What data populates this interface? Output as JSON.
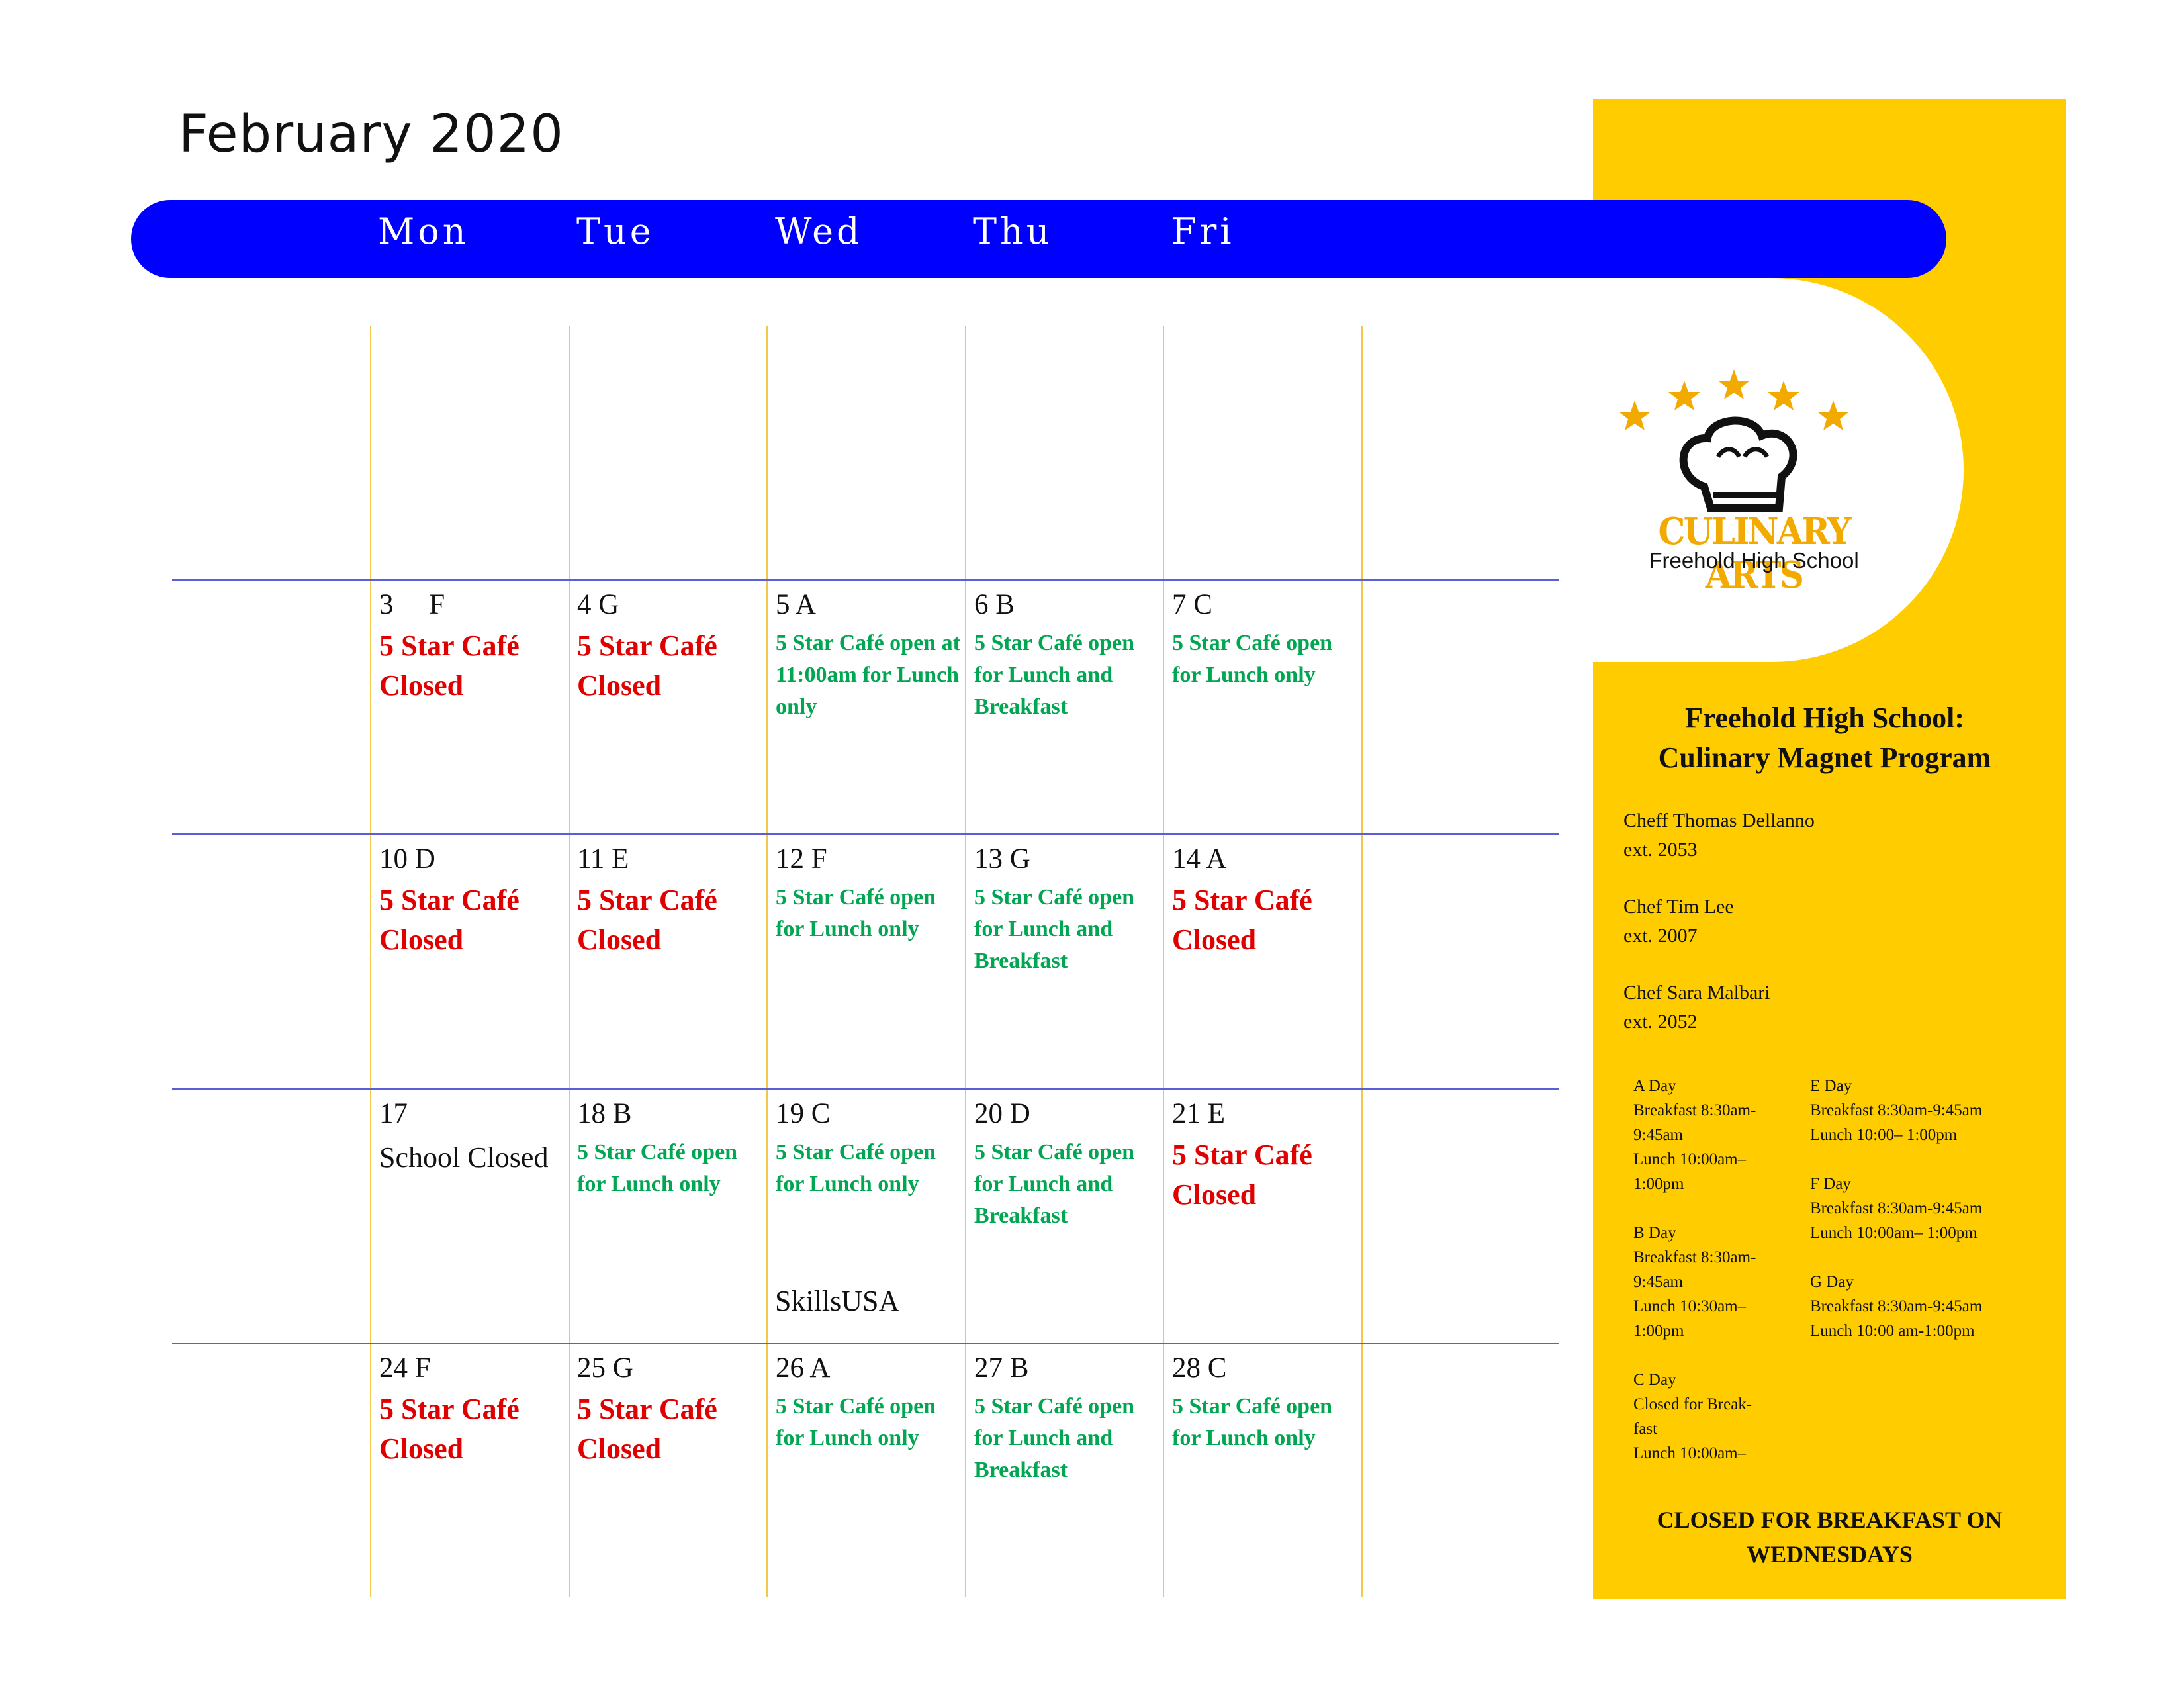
{
  "header": {
    "month_title": "February 2020"
  },
  "days": [
    "Mon",
    "Tue",
    "Wed",
    "Thu",
    "Fri"
  ],
  "colors": {
    "bar": "#0000ff",
    "sidebar": "#ffcc00",
    "closed": "#e00000",
    "open": "#00a651",
    "logo_gold": "#f2a900"
  },
  "weeks": [
    [
      {
        "date": "3     F",
        "status": "5 Star Café Closed",
        "kind": "closed"
      },
      {
        "date": "4 G",
        "status": "5 Star Café Closed",
        "kind": "closed"
      },
      {
        "date": "5 A",
        "status": "5 Star Café open at 11:00am  for Lunch only",
        "kind": "open"
      },
      {
        "date": "6 B",
        "status": "5 Star Café open for Lunch and Breakfast",
        "kind": "open"
      },
      {
        "date": "7 C",
        "status": "5 Star Café open for Lunch only",
        "kind": "open"
      }
    ],
    [
      {
        "date": "10 D",
        "status": "5 Star Café Closed",
        "kind": "closed"
      },
      {
        "date": "11 E",
        "status": "5 Star Café Closed",
        "kind": "closed"
      },
      {
        "date": "12 F",
        "status": "5 Star Café open for Lunch only",
        "kind": "open"
      },
      {
        "date": "13 G",
        "status": "5 Star Café open for Lunch and Breakfast",
        "kind": "open"
      },
      {
        "date": "14 A",
        "status": "5 Star Café Closed",
        "kind": "closed"
      }
    ],
    [
      {
        "date": "17",
        "status": "School Closed",
        "kind": "plain"
      },
      {
        "date": "18 B",
        "status": "5 Star Café open for Lunch only",
        "kind": "open"
      },
      {
        "date": "19 C",
        "status": "5 Star Café open for Lunch only",
        "kind": "open"
      },
      {
        "date": "20 D",
        "status": "5 Star Café open for Lunch and Breakfast",
        "kind": "open"
      },
      {
        "date": "21 E",
        "status": "5 Star Café Closed",
        "kind": "closed"
      }
    ],
    [
      {
        "date": "24 F",
        "status": "5 Star Café Closed",
        "kind": "closed"
      },
      {
        "date": "25 G",
        "status": "5 Star Café Closed",
        "kind": "closed"
      },
      {
        "date": "26 A",
        "status": "5 Star Café open for Lunch only",
        "kind": "open"
      },
      {
        "date": "27 B",
        "status": "5 Star Café open for Lunch and Breakfast",
        "kind": "open"
      },
      {
        "date": "28 C",
        "status": "5 Star Café open for Lunch only",
        "kind": "open"
      }
    ]
  ],
  "events": {
    "wed_19": "SkillsUSA"
  },
  "logo": {
    "title": "CULINARY ARTS",
    "subtitle": "Freehold High School",
    "icon": "chef-hat-icon"
  },
  "sidebar": {
    "program_title_line1": "Freehold High School:",
    "program_title_line2": "Culinary Magnet Program",
    "chefs": [
      {
        "name": "Cheff Thomas Dellanno",
        "ext": "ext. 2053"
      },
      {
        "name": "Chef Tim Lee",
        "ext": "ext. 2007"
      },
      {
        "name": "Chef Sara Malbari",
        "ext": "ext. 2052"
      }
    ],
    "schedule_left": [
      {
        "day": "A Day",
        "lines": [
          "Breakfast 8:30am-",
          "9:45am",
          "Lunch 10:00am–",
          "1:00pm"
        ]
      },
      {
        "day": "B Day",
        "lines": [
          "Breakfast 8:30am-",
          "9:45am",
          "Lunch 10:30am–",
          "1:00pm"
        ]
      },
      {
        "day": "C Day",
        "lines": [
          "Closed for Break-",
          "fast",
          "Lunch 10:00am–"
        ]
      }
    ],
    "schedule_right": [
      {
        "day": "E Day",
        "lines": [
          "Breakfast 8:30am-9:45am",
          "Lunch 10:00– 1:00pm"
        ]
      },
      {
        "day": "F Day",
        "lines": [
          "Breakfast 8:30am-9:45am",
          "Lunch 10:00am– 1:00pm"
        ]
      },
      {
        "day": "G Day",
        "lines": [
          "Breakfast 8:30am-9:45am",
          "Lunch 10:00 am-1:00pm"
        ]
      }
    ],
    "footer_line1": "CLOSED FOR BREAKFAST ON",
    "footer_line2": "WEDNESDAYS"
  }
}
